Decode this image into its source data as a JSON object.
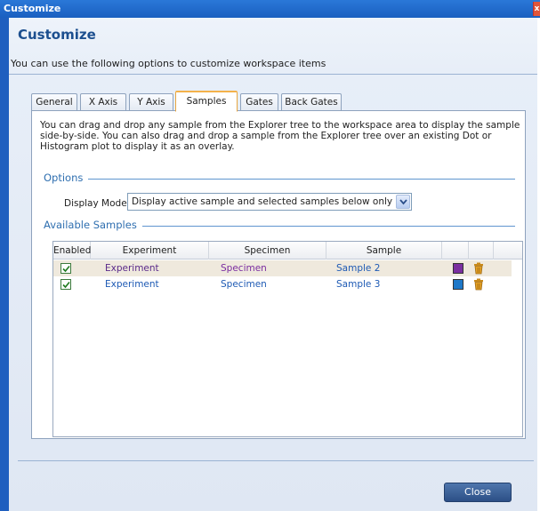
{
  "window": {
    "title": "Customize",
    "close_glyph": "x"
  },
  "header": {
    "title": "Customize",
    "description": "You can use the following options to customize workspace items"
  },
  "tabs": [
    {
      "label": "General"
    },
    {
      "label": "X Axis"
    },
    {
      "label": "Y Axis"
    },
    {
      "label": "Samples"
    },
    {
      "label": "Gates"
    },
    {
      "label": "Back Gates"
    }
  ],
  "panel": {
    "description": "You can drag and drop any sample from the Explorer tree to the workspace area to display the sample side-by-side.  You can also drag and drop a sample from the Explorer tree over an existing Dot or Histogram plot to display it as an overlay.",
    "options_label": "Options",
    "display_mode_label": "Display Mode:",
    "display_mode_value": "Display active sample and selected samples below only",
    "available_label": "Available Samples"
  },
  "table": {
    "columns": [
      "Enabled",
      "Experiment",
      "Specimen",
      "Sample"
    ],
    "rows": [
      {
        "enabled": true,
        "experiment": "Experiment",
        "specimen": "Specimen",
        "sample": "Sample 2",
        "color": "#7b2fa0"
      },
      {
        "enabled": true,
        "experiment": "Experiment",
        "specimen": "Specimen",
        "sample": "Sample 3",
        "color": "#1e78c8"
      }
    ]
  },
  "footer": {
    "close_label": "Close"
  },
  "colors": {
    "accent": "#1f5fbf",
    "experiment_text": "#5a2a8a",
    "specimen_text": "#7a2ca0",
    "sample_text": "#1e5ab4"
  }
}
